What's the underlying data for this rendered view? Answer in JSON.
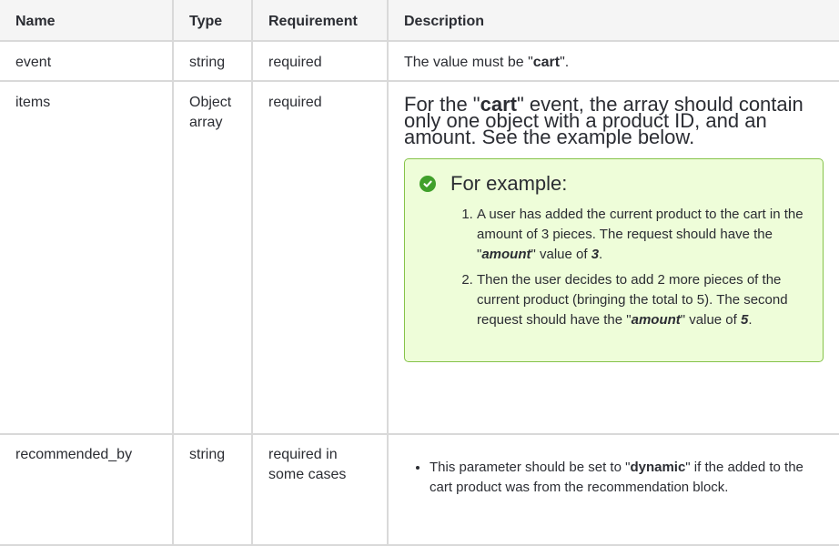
{
  "headers": {
    "name": "Name",
    "type": "Type",
    "requirement": "Requirement",
    "description": "Description"
  },
  "rows": {
    "event": {
      "name": "event",
      "type": "string",
      "requirement": "required",
      "desc_pre": "The value must be \"",
      "desc_bold": "cart",
      "desc_post": "\"."
    },
    "items": {
      "name": "items",
      "type_line1": "Object",
      "type_line2": "array",
      "requirement": "required",
      "lead_pre": "For the \"",
      "lead_bold": "cart",
      "lead_post": "\" event, the array should contain only one object with a product ID, and an amount. See the example below.",
      "callout_title": "For example:",
      "example1_pre": "A user has added the current product to the cart in the amount of 3 pieces. The request should have the \"",
      "example1_key": "amount",
      "example1_mid": "\" value of ",
      "example1_val": "3",
      "example1_post": ".",
      "example2_pre": "Then the user decides to add 2 more pieces of the current product (bringing the total to 5). The second request should have the \"",
      "example2_key": "amount",
      "example2_mid": "\" value of ",
      "example2_val": "5",
      "example2_post": "."
    },
    "recommended_by": {
      "name": "recommended_by",
      "type": "string",
      "requirement_line1": "required in",
      "requirement_line2": "some cases",
      "bullet_pre": "This parameter should be set to \"",
      "bullet_bold": "dynamic",
      "bullet_post": "\" if the added to the cart product was from the recommendation block."
    }
  },
  "colors": {
    "header_bg": "#f5f5f5",
    "border": "#d9d9d9",
    "callout_bg": "#eefdd9",
    "callout_border": "#86c34a",
    "check_green": "#40a02b"
  },
  "icons": {
    "callout": "check-circle-icon"
  }
}
